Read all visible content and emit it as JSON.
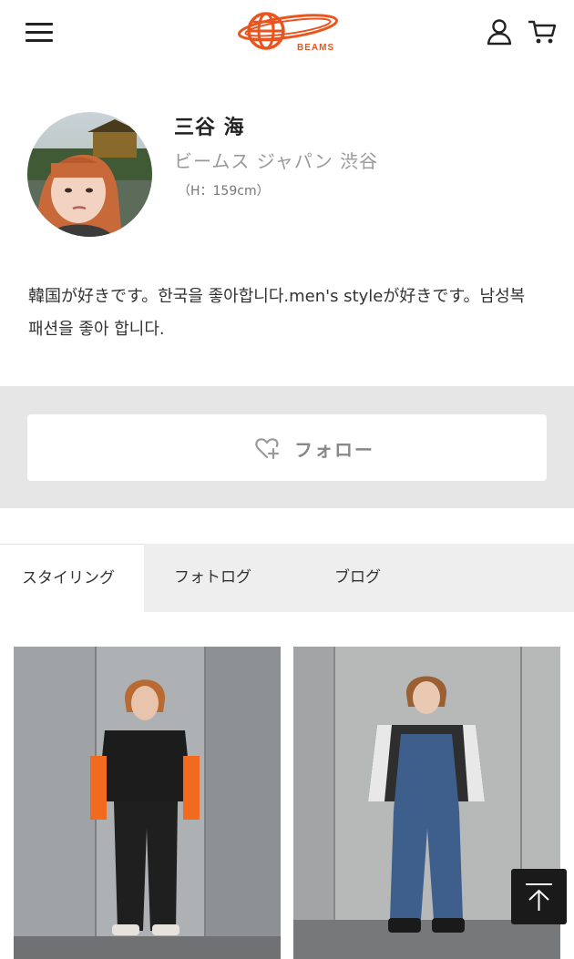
{
  "header": {
    "logo_text": "BEAMS",
    "icons": {
      "menu": "hamburger-menu-icon",
      "user": "user-icon",
      "cart": "cart-icon"
    },
    "brand_color": "#e8551f"
  },
  "profile": {
    "name": "三谷 海",
    "shop": "ビームス ジャパン 渋谷",
    "height": "（H：159cm）",
    "bio": "韓国が好きです。한국을 좋아합니다.men's styleが好きです。남성복 패션을 좋아 합니다."
  },
  "follow": {
    "label": "フォロー",
    "icon": "heart-plus-icon"
  },
  "tabs": [
    {
      "label": "スタイリング",
      "active": true
    },
    {
      "label": "フォトログ",
      "active": false
    },
    {
      "label": "ブログ",
      "active": false
    }
  ],
  "to_top": {
    "icon": "arrow-to-top-icon"
  }
}
